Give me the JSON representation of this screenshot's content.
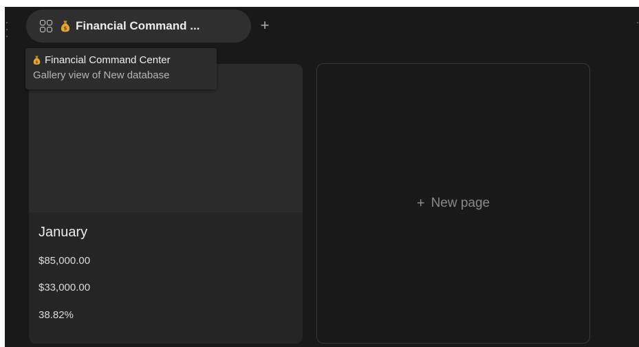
{
  "tabs": [
    {
      "label": "Financial Command ...",
      "icon": "money-bag-icon",
      "view_icon": "gallery-icon"
    }
  ],
  "add_tab_label": "+",
  "tooltip": {
    "title": "Financial Command Center",
    "subtitle": "Gallery view of New database"
  },
  "cards": [
    {
      "title": "January",
      "properties": [
        "$85,000.00",
        "$33,000.00",
        "38.82%"
      ]
    }
  ],
  "new_page": {
    "plus": "+",
    "label": "New page"
  },
  "colors": {
    "background": "#191919",
    "tab": "#2f2f2f",
    "card": "#252525",
    "cover": "#2b2b2b",
    "money_bag": "#e0a63a"
  }
}
